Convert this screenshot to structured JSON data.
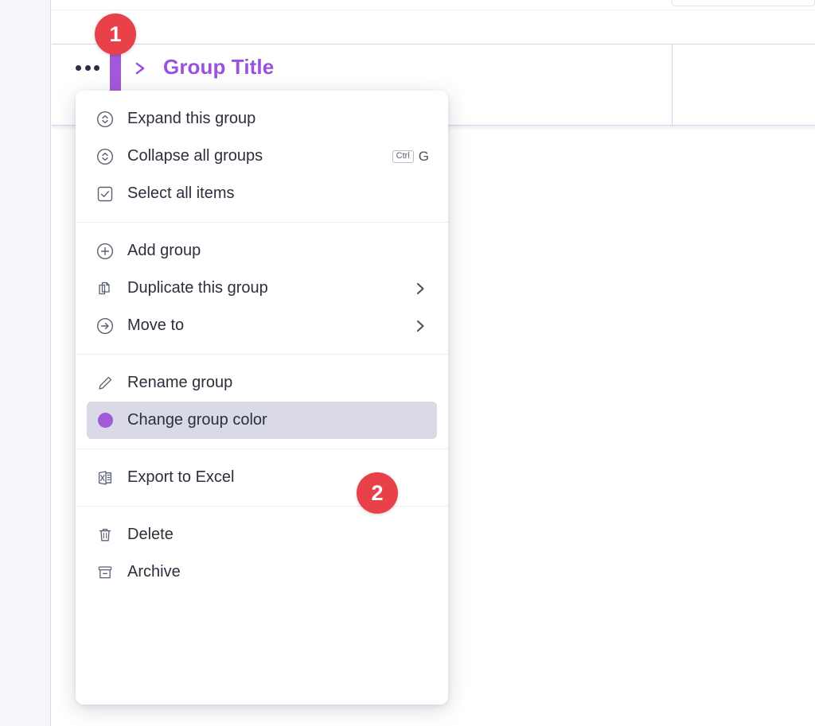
{
  "board": {
    "group": {
      "title": "Group Title",
      "color": "#9b51e0",
      "caret_icon": "chevron-right-icon",
      "kebab_icon": "more-options-icon"
    }
  },
  "context_menu": {
    "sections": [
      {
        "items": [
          {
            "label": "Expand this group",
            "icon": "expand-circle-icon",
            "shortcut": null,
            "submenu": false,
            "active": false
          },
          {
            "label": "Collapse all groups",
            "icon": "collapse-circle-icon",
            "shortcut": {
              "key": "Ctrl",
              "letter": "G"
            },
            "submenu": false,
            "active": false
          },
          {
            "label": "Select all items",
            "icon": "checkbox-check-icon",
            "shortcut": null,
            "submenu": false,
            "active": false
          }
        ]
      },
      {
        "items": [
          {
            "label": "Add group",
            "icon": "plus-circle-icon",
            "shortcut": null,
            "submenu": false,
            "active": false
          },
          {
            "label": "Duplicate this group",
            "icon": "duplicate-icon",
            "shortcut": null,
            "submenu": true,
            "active": false
          },
          {
            "label": "Move to",
            "icon": "arrow-right-circle-icon",
            "shortcut": null,
            "submenu": true,
            "active": false
          }
        ]
      },
      {
        "items": [
          {
            "label": "Rename group",
            "icon": "pencil-icon",
            "shortcut": null,
            "submenu": false,
            "active": false
          },
          {
            "label": "Change group color",
            "icon": "color-swatch-icon",
            "shortcut": null,
            "submenu": false,
            "active": true
          }
        ]
      },
      {
        "items": [
          {
            "label": "Export to Excel",
            "icon": "excel-file-icon",
            "shortcut": null,
            "submenu": false,
            "active": false
          }
        ]
      },
      {
        "items": [
          {
            "label": "Delete",
            "icon": "trash-icon",
            "shortcut": null,
            "submenu": false,
            "active": false
          },
          {
            "label": "Archive",
            "icon": "archive-icon",
            "shortcut": null,
            "submenu": false,
            "active": false
          }
        ]
      }
    ]
  },
  "callouts": [
    {
      "number": "1",
      "target": "group-kebab-menu"
    },
    {
      "number": "2",
      "target": "change-group-color"
    }
  ],
  "colors": {
    "accent_purple": "#a259d9",
    "title_purple": "#9b51e0",
    "callout_red": "#e8414a",
    "active_row": "#d9d9e7"
  }
}
